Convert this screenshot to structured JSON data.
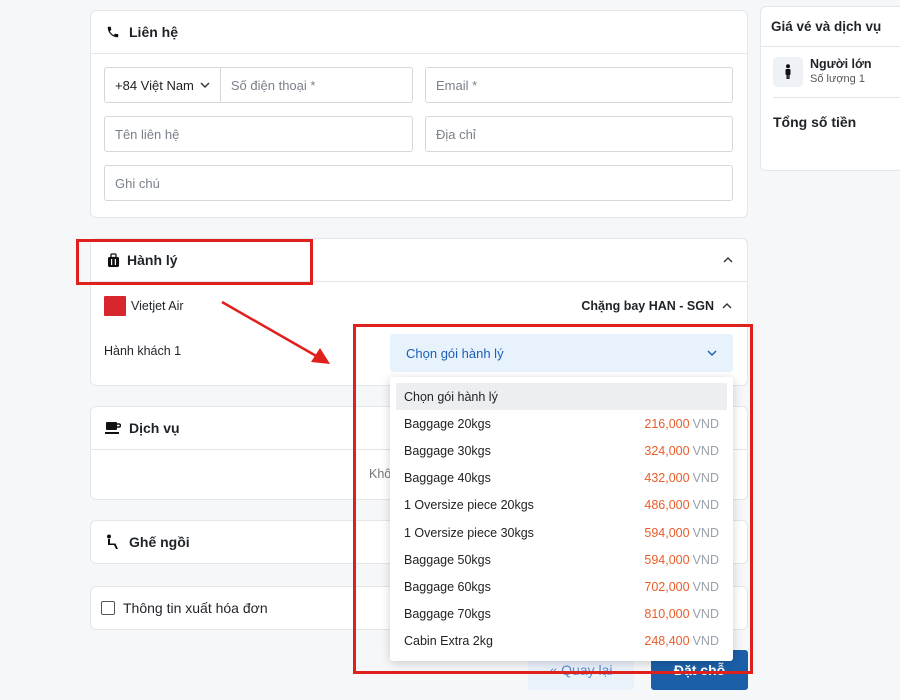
{
  "contact": {
    "title": "Liên hệ",
    "phone_code": "+84 Việt Nam",
    "phone_placeholder": "Số điện thoại *",
    "email_placeholder": "Email *",
    "name_placeholder": "Tên liên hệ",
    "address_placeholder": "Địa chỉ",
    "note_placeholder": "Ghi chú"
  },
  "baggage": {
    "title": "Hành lý",
    "airline": "Vietjet Air",
    "leg": "Chặng bay HAN - SGN",
    "passenger": "Hành khách 1",
    "select_value": "Chọn gói hành lý",
    "options": [
      {
        "label": "Chọn gói hành lý",
        "price": "",
        "currency": ""
      },
      {
        "label": "Baggage 20kgs",
        "price": "216,000",
        "currency": "VND"
      },
      {
        "label": "Baggage 30kgs",
        "price": "324,000",
        "currency": "VND"
      },
      {
        "label": "Baggage 40kgs",
        "price": "432,000",
        "currency": "VND"
      },
      {
        "label": "1 Oversize piece 20kgs",
        "price": "486,000",
        "currency": "VND"
      },
      {
        "label": "1 Oversize piece 30kgs",
        "price": "594,000",
        "currency": "VND"
      },
      {
        "label": "Baggage 50kgs",
        "price": "594,000",
        "currency": "VND"
      },
      {
        "label": "Baggage 60kgs",
        "price": "702,000",
        "currency": "VND"
      },
      {
        "label": "Baggage 70kgs",
        "price": "810,000",
        "currency": "VND"
      },
      {
        "label": "Cabin Extra 2kg",
        "price": "248,400",
        "currency": "VND"
      }
    ]
  },
  "service": {
    "title": "Dịch vụ",
    "empty_text": "Khô"
  },
  "seat": {
    "title": "Ghế ngồi"
  },
  "invoice": {
    "label": "Thông tin xuất hóa đơn"
  },
  "buttons": {
    "back": "« Quay lại",
    "book": "Đặt chỗ"
  },
  "summary": {
    "title": "Giá vé và dịch vụ",
    "passenger_type": "Người lớn",
    "quantity": "Số lượng 1",
    "total": "Tổng số tiền"
  },
  "colors": {
    "accent": "#1a5fb4",
    "price": "#e85d2a",
    "annotation": "#e0201d",
    "book_button": "#1b5fa8"
  }
}
